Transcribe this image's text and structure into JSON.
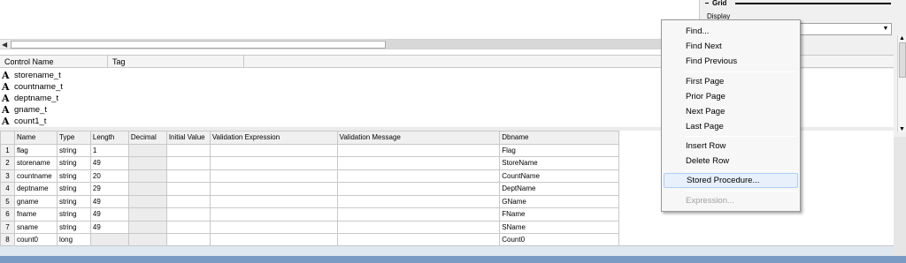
{
  "props_panel": {
    "section_title": "Grid",
    "display_label": "Display",
    "combo_value": ""
  },
  "control_list": {
    "columns": [
      "Control Name",
      "Tag"
    ],
    "items": [
      "storename_t",
      "countname_t",
      "deptname_t",
      "gname_t",
      "count1_t"
    ]
  },
  "grid": {
    "columns": [
      "",
      "Name",
      "Type",
      "Length",
      "Decimal",
      "Initial Value",
      "Validation Expression",
      "Validation Message",
      "Dbname"
    ],
    "rows": [
      [
        "1",
        "flag",
        "string",
        "1",
        "",
        "",
        "",
        "",
        "Flag"
      ],
      [
        "2",
        "storename",
        "string",
        "49",
        "",
        "",
        "",
        "",
        "StoreName"
      ],
      [
        "3",
        "countname",
        "string",
        "20",
        "",
        "",
        "",
        "",
        "CountName"
      ],
      [
        "4",
        "deptname",
        "string",
        "29",
        "",
        "",
        "",
        "",
        "DeptName"
      ],
      [
        "5",
        "gname",
        "string",
        "49",
        "",
        "",
        "",
        "",
        "GName"
      ],
      [
        "6",
        "fname",
        "string",
        "49",
        "",
        "",
        "",
        "",
        "FName"
      ],
      [
        "7",
        "sname",
        "string",
        "49",
        "",
        "",
        "",
        "",
        "SName"
      ],
      [
        "8",
        "count0",
        "long",
        "",
        "",
        "",
        "",
        "",
        "Count0"
      ]
    ]
  },
  "context_menu": {
    "find": "Find...",
    "find_next": "Find Next",
    "find_previous": "Find Previous",
    "first_page": "First Page",
    "prior_page": "Prior Page",
    "next_page": "Next Page",
    "last_page": "Last Page",
    "insert_row": "Insert Row",
    "delete_row": "Delete Row",
    "stored_procedure": "Stored Procedure...",
    "expression": "Expression..."
  },
  "icons": {
    "text_control": "text-control-icon",
    "scroll_left": "scroll-left-arrow-icon",
    "dropdown": "dropdown-arrow-icon"
  },
  "colors": {
    "menu_highlight": "#e7f0fb",
    "menu_highlight_border": "#aecff7",
    "disabled_text": "#a0a0a0"
  }
}
